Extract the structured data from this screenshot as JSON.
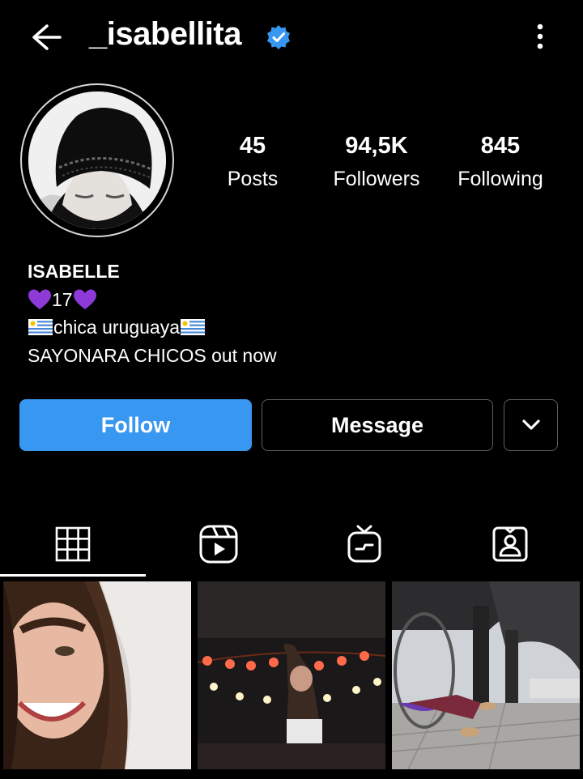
{
  "header": {
    "username": "_isabellita",
    "verified_icon": "verified-badge-icon",
    "back_icon": "arrow-left-icon",
    "more_icon": "more-vertical-icon"
  },
  "stats": [
    {
      "value": "45",
      "label": "Posts"
    },
    {
      "value": "94,5K",
      "label": "Followers"
    },
    {
      "value": "845",
      "label": "Following"
    }
  ],
  "bio": {
    "name": "ISABELLE",
    "line1": "17",
    "line2": "chica uruguaya",
    "line3": "SAYONARA CHICOS out now"
  },
  "actions": {
    "follow": "Follow",
    "message": "Message"
  },
  "tabs": [
    {
      "icon": "grid-icon"
    },
    {
      "icon": "reels-icon"
    },
    {
      "icon": "igtv-icon"
    },
    {
      "icon": "tagged-icon"
    }
  ],
  "colors": {
    "accent": "#3897f0",
    "verified": "#3897f0",
    "background": "#000000",
    "heart": "#8e3ad8"
  }
}
